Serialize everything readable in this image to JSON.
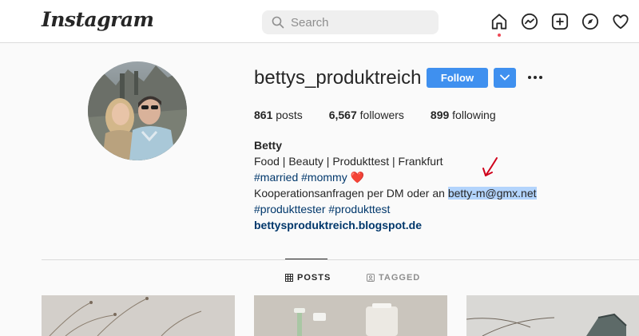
{
  "header": {
    "logo": "Instagram",
    "search_placeholder": "Search"
  },
  "profile": {
    "username": "bettys_produktreich",
    "follow_label": "Follow",
    "stats": {
      "posts_count": "861",
      "posts_label": "posts",
      "followers_count": "6,567",
      "followers_label": "followers",
      "following_count": "899",
      "following_label": "following"
    },
    "bio": {
      "name": "Betty",
      "line1": "Food | Beauty | Produkttest | Frankfurt",
      "hashtags1": "#married #mommy",
      "heart": "❤️",
      "line3_prefix": "Kooperationsanfragen per DM oder an ",
      "email": "betty-m@gmx.net",
      "hashtags2": "#produkttester #produkttest",
      "website": "bettysproduktreich.blogspot.de"
    }
  },
  "tabs": {
    "posts": "POSTS",
    "tagged": "TAGGED"
  },
  "icons": {
    "nav": [
      "home-icon",
      "messenger-icon",
      "new-post-icon",
      "explore-icon",
      "activity-heart-icon"
    ]
  },
  "colors": {
    "accent": "#3f90ef",
    "link": "#00376b",
    "highlight": "#b3d4fc",
    "notification": "#ed4956",
    "annotation_arrow": "#d0021b"
  }
}
